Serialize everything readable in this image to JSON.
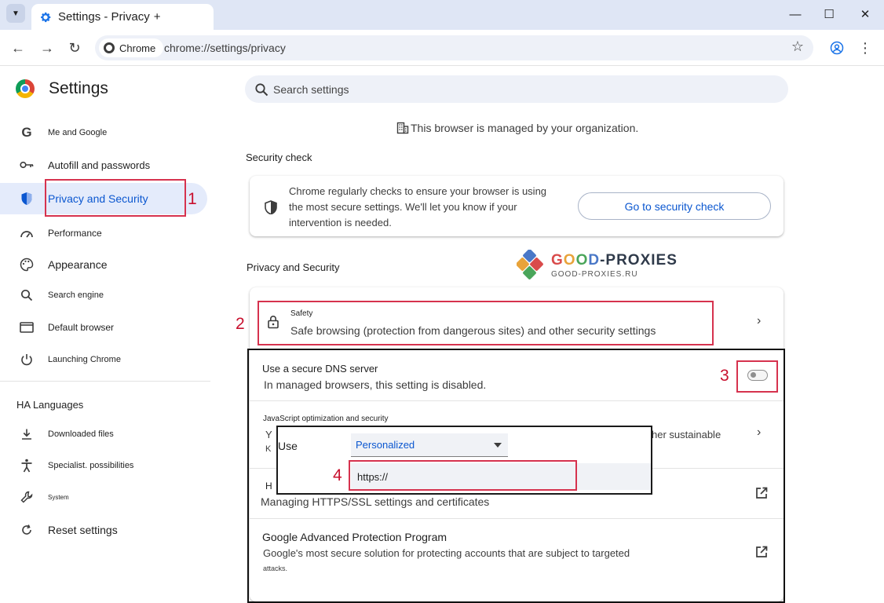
{
  "window": {
    "tab_title": "Settings - Privacy",
    "new_tab": "+",
    "minimize": "—",
    "maximize": "☐",
    "close": "✕"
  },
  "toolbar": {
    "back": "←",
    "forward": "→",
    "reload": "↻",
    "chip_label": "Chrome",
    "url": "chrome://settings/privacy",
    "star": "☆",
    "menu": "⋮"
  },
  "sidebar": {
    "title": "Settings",
    "items": [
      {
        "label": "Me and Google",
        "icon": "google-g-icon"
      },
      {
        "label": "Autofill and passwords",
        "icon": "key-icon"
      },
      {
        "label": "Privacy and Security",
        "icon": "shield-icon"
      },
      {
        "label": "Performance",
        "icon": "speedometer-icon"
      },
      {
        "label": "Appearance",
        "icon": "palette-icon"
      },
      {
        "label": "Search engine",
        "icon": "search-icon"
      },
      {
        "label": "Default browser",
        "icon": "browser-window-icon"
      },
      {
        "label": "Launching Chrome",
        "icon": "power-icon"
      }
    ],
    "languages_header": "HA Languages",
    "items2": [
      {
        "label": "Downloaded files",
        "icon": "download-icon"
      },
      {
        "label": "Specialist. possibilities",
        "icon": "accessibility-icon"
      },
      {
        "label": "System",
        "icon": "wrench-icon"
      },
      {
        "label": "Reset settings",
        "icon": "reset-icon"
      }
    ]
  },
  "main": {
    "search_placeholder": "Search settings",
    "managed_notice": "This browser is managed by your organization.",
    "security_check": {
      "section_title": "Security check",
      "description": "Chrome regularly checks to ensure your browser is using the most secure settings. We'll let you know if your intervention is needed.",
      "button": "Go to security check"
    },
    "privacy_section_title": "Privacy and Security",
    "safety": {
      "title": "Safety",
      "subtitle": "Safe browsing (protection from dangerous sites) and other security settings"
    },
    "dns": {
      "title": "Use a secure DNS server",
      "subtitle": "In managed browsers, this setting is disabled.",
      "toggle_on": false,
      "use_label": "Use",
      "select_value": "Personalized",
      "input_value": "https://"
    },
    "js": {
      "title": "JavaScript optimization and security",
      "subtitle_prefix": "Y",
      "subtitle_suffix": "her sustainable",
      "subtitle_line2": "K"
    },
    "https": {
      "title_prefix": "H",
      "subtitle": "Managing HTTPS/SSL settings and certificates"
    },
    "advanced": {
      "title": "Google Advanced Protection Program",
      "subtitle": "Google's most secure solution for protecting accounts that are subject to targeted",
      "subtitle_line2": "attacks."
    }
  },
  "watermark": {
    "brand_parts": [
      "G",
      "O",
      "O",
      "D",
      "-PROXIES"
    ],
    "url": "GOOD-PROXIES.RU"
  },
  "annotations": [
    "1",
    "2",
    "3",
    "4"
  ],
  "colors": {
    "accent": "#0b57d0",
    "highlight": "#d6324e",
    "active_bg": "#e4ebfb"
  }
}
